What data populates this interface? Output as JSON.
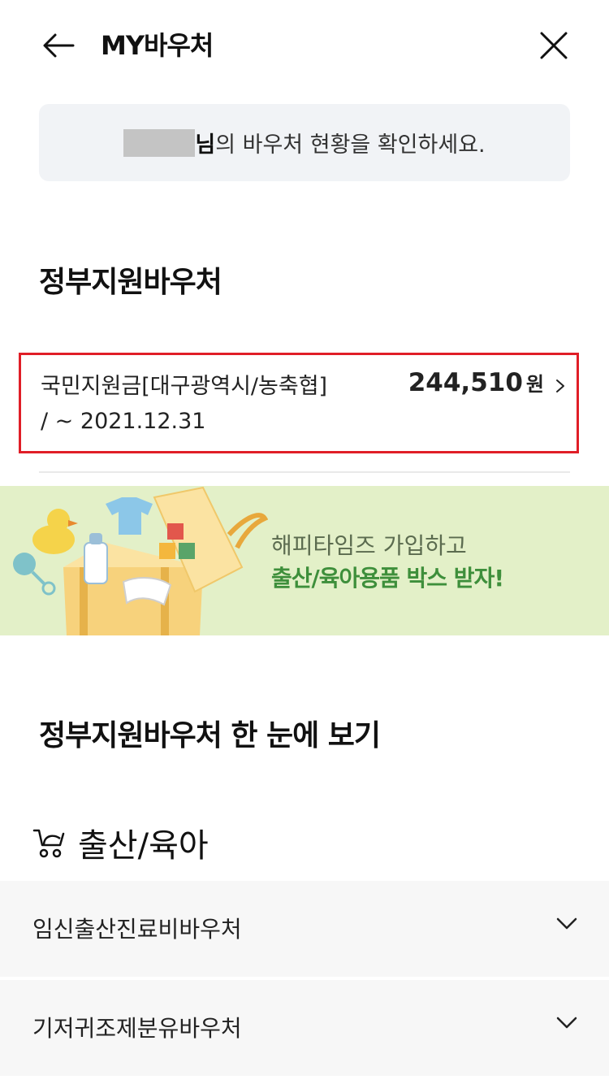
{
  "header": {
    "title": "MY바우처"
  },
  "greeting": {
    "suffix_bold": "님",
    "message": "의 바우처 현황을 확인하세요."
  },
  "gov_voucher_section": {
    "title": "정부지원바우처",
    "items": [
      {
        "name": "국민지원금[대구광역시/농축협]",
        "period": "/ ~ 2021.12.31",
        "amount": "244,510",
        "unit": "원"
      }
    ]
  },
  "banner": {
    "line1": "해피타임즈 가입하고",
    "line2": "출산/육아용품 박스 받자!",
    "colors": {
      "background": "#e3f0c8",
      "highlight": "#3e8f3b"
    }
  },
  "overview_section": {
    "title": "정부지원바우처 한 눈에 보기",
    "category": {
      "icon": "stroller-icon",
      "label": "출산/육아"
    },
    "items": [
      {
        "label": "임신출산진료비바우처"
      },
      {
        "label": "기저귀조제분유바우처"
      }
    ]
  },
  "accent": {
    "highlight_border": "#e01e27"
  }
}
